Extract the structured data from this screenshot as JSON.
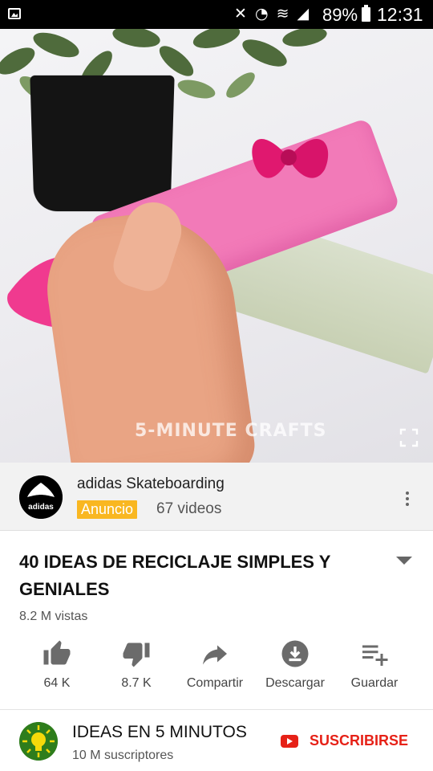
{
  "status_bar": {
    "icons": "✕ ◔ ≋ ◢",
    "battery": "89%",
    "time": "12:31"
  },
  "video": {
    "watermark": "5-MINUTE CRAFTS",
    "progress_fraction": 0.11,
    "colors": {
      "progress": "#e62117",
      "ad_marker": "#f1c40f"
    }
  },
  "ad": {
    "channel": "adidas Skateboarding",
    "badge": "Anuncio",
    "video_count": "67 videos",
    "logo_text": "adidas"
  },
  "video_info": {
    "title": "40 IDEAS DE RECICLAJE SIMPLES Y GENIALES",
    "views": "8.2 M vistas"
  },
  "actions": [
    {
      "label": "64 K",
      "icon": "thumbs-up-icon"
    },
    {
      "label": "8.7 K",
      "icon": "thumbs-down-icon"
    },
    {
      "label": "Compartir",
      "icon": "share-icon"
    },
    {
      "label": "Descargar",
      "icon": "download-icon"
    },
    {
      "label": "Guardar",
      "icon": "playlist-add-icon"
    }
  ],
  "channel": {
    "name": "IDEAS EN 5 MINUTOS",
    "subscribers": "10 M suscriptores",
    "subscribe_label": "SUSCRIBIRSE",
    "brand_color": "#e62117"
  }
}
